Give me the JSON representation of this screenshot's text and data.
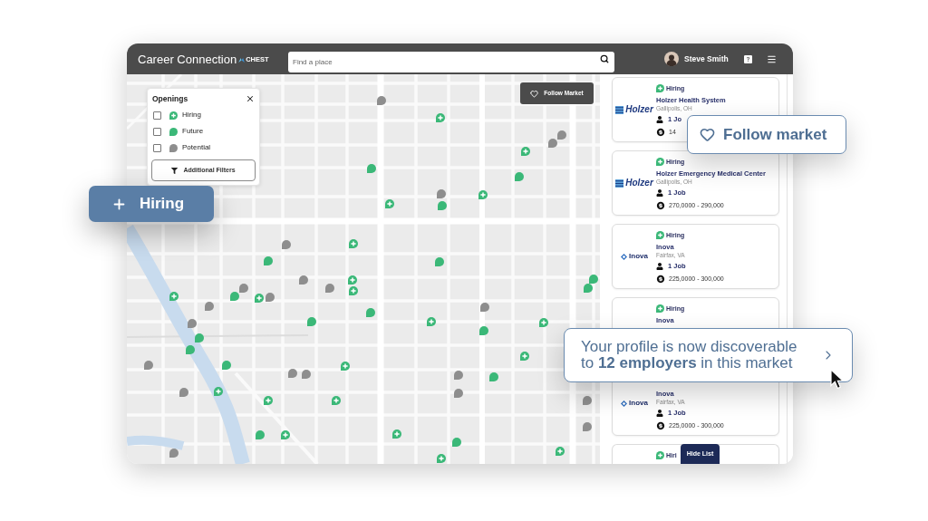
{
  "header": {
    "title": "Career Connection",
    "brand": "CHEST",
    "search": {
      "placeholder": "Find a place"
    },
    "user": {
      "name": "Steve Smith"
    }
  },
  "filter_panel": {
    "title": "Openings",
    "options": [
      {
        "label": "Hiring",
        "kind": "hiring",
        "checked": false
      },
      {
        "label": "Future",
        "kind": "future",
        "checked": false
      },
      {
        "label": "Potential",
        "kind": "potential",
        "checked": false
      }
    ],
    "button": "Additional Filters"
  },
  "map": {
    "follow_button": "Follow Market",
    "markers": [
      {
        "kind": "potential"
      },
      {
        "kind": "hiring"
      },
      {
        "kind": "potential"
      },
      {
        "kind": "potential"
      },
      {
        "kind": "hiring"
      },
      {
        "kind": "future"
      },
      {
        "kind": "future"
      },
      {
        "kind": "potential"
      },
      {
        "kind": "hiring"
      },
      {
        "kind": "hiring"
      },
      {
        "kind": "future"
      },
      {
        "kind": "potential"
      },
      {
        "kind": "hiring"
      },
      {
        "kind": "future"
      },
      {
        "kind": "future"
      },
      {
        "kind": "potential"
      },
      {
        "kind": "hiring"
      },
      {
        "kind": "potential"
      },
      {
        "kind": "potential"
      },
      {
        "kind": "hiring"
      },
      {
        "kind": "future"
      },
      {
        "kind": "future"
      },
      {
        "kind": "hiring"
      },
      {
        "kind": "future"
      },
      {
        "kind": "hiring"
      },
      {
        "kind": "potential"
      },
      {
        "kind": "potential"
      },
      {
        "kind": "potential"
      },
      {
        "kind": "future"
      },
      {
        "kind": "potential"
      },
      {
        "kind": "future"
      },
      {
        "kind": "hiring"
      },
      {
        "kind": "hiring"
      },
      {
        "kind": "future"
      },
      {
        "kind": "future"
      },
      {
        "kind": "future"
      },
      {
        "kind": "hiring"
      },
      {
        "kind": "potential"
      },
      {
        "kind": "future"
      },
      {
        "kind": "hiring"
      },
      {
        "kind": "potential"
      },
      {
        "kind": "potential"
      },
      {
        "kind": "potential"
      },
      {
        "kind": "future"
      },
      {
        "kind": "potential"
      },
      {
        "kind": "hiring"
      },
      {
        "kind": "potential"
      },
      {
        "kind": "hiring"
      },
      {
        "kind": "hiring"
      },
      {
        "kind": "potential"
      },
      {
        "kind": "potential"
      },
      {
        "kind": "future"
      },
      {
        "kind": "hiring"
      },
      {
        "kind": "hiring"
      },
      {
        "kind": "future"
      },
      {
        "kind": "potential"
      },
      {
        "kind": "hiring"
      },
      {
        "kind": "hiring"
      }
    ]
  },
  "list": {
    "cards": [
      {
        "logo": {
          "kind": "striped",
          "text": "Holzer"
        },
        "badge": {
          "kind": "hiring",
          "label": "Hiring"
        },
        "name": "Holzer Health System",
        "location": "Gallipolis, OH",
        "jobs": "1 Jo",
        "salary": "14"
      },
      {
        "logo": {
          "kind": "striped",
          "text": "Holzer"
        },
        "badge": {
          "kind": "hiring",
          "label": "Hiring"
        },
        "name": "Holzer Emergency Medical Center",
        "location": "Gallipolis, OH",
        "jobs": "1 Job",
        "salary": "270,0000 - 290,000"
      },
      {
        "logo": {
          "kind": "knot",
          "text": "Inova"
        },
        "badge": {
          "kind": "hiring",
          "label": "Hiring"
        },
        "name": "Inova",
        "location": "Fairfax, VA",
        "jobs": "1 Job",
        "salary": "225,0000 - 300,000"
      },
      {
        "badge": {
          "kind": "hiring",
          "label": "Hiring"
        },
        "name": "Inova"
      },
      {
        "logo": {
          "kind": "knot",
          "text": "Inova"
        },
        "name": "Inova",
        "location": "Fairfax, VA",
        "jobs": "1 Job",
        "salary": "225,0000 - 300,000"
      },
      {
        "badge": {
          "kind": "hiring",
          "label": "Hiri"
        }
      }
    ],
    "hide_button": "Hide List"
  },
  "callouts": [
    {
      "kind": "chip",
      "label": "Hiring"
    },
    {
      "kind": "follow",
      "label": "Follow market"
    },
    {
      "kind": "notice",
      "text": "Your profile is now discoverable to **12 employers** in this market"
    }
  ]
}
